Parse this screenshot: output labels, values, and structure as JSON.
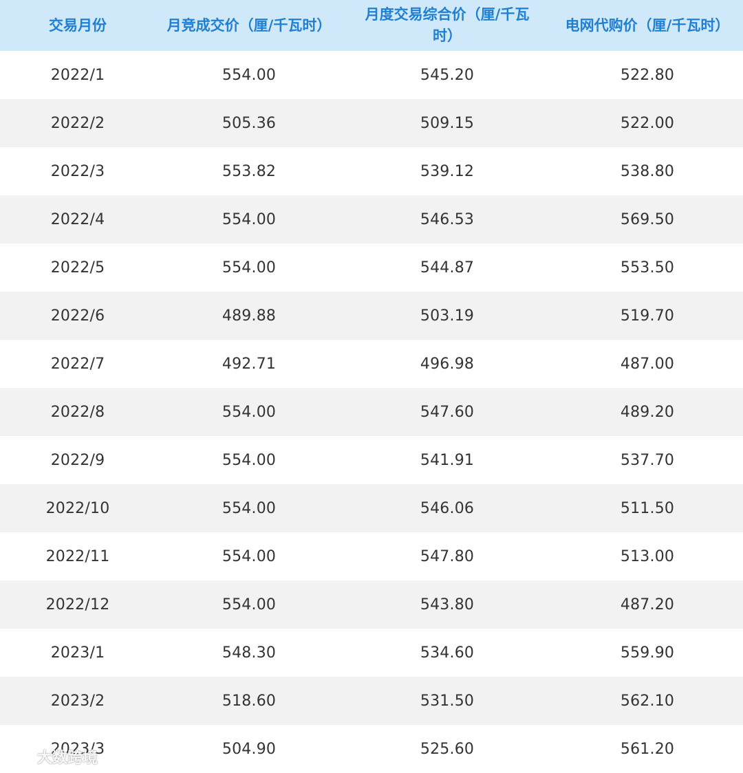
{
  "table": {
    "headers": [
      "交易月份",
      "月竞成交价（厘/千瓦时）",
      "月度交易综合价（厘/千瓦时）",
      "电网代购价（厘/千瓦时）"
    ],
    "rows": [
      [
        "2022/1",
        "554.00",
        "545.20",
        "522.80"
      ],
      [
        "2022/2",
        "505.36",
        "509.15",
        "522.00"
      ],
      [
        "2022/3",
        "553.82",
        "539.12",
        "538.80"
      ],
      [
        "2022/4",
        "554.00",
        "546.53",
        "569.50"
      ],
      [
        "2022/5",
        "554.00",
        "544.87",
        "553.50"
      ],
      [
        "2022/6",
        "489.88",
        "503.19",
        "519.70"
      ],
      [
        "2022/7",
        "492.71",
        "496.98",
        "487.00"
      ],
      [
        "2022/8",
        "554.00",
        "547.60",
        "489.20"
      ],
      [
        "2022/9",
        "554.00",
        "541.91",
        "537.70"
      ],
      [
        "2022/10",
        "554.00",
        "546.06",
        "511.50"
      ],
      [
        "2022/11",
        "554.00",
        "547.80",
        "513.00"
      ],
      [
        "2022/12",
        "554.00",
        "543.80",
        "487.20"
      ],
      [
        "2023/1",
        "548.30",
        "534.60",
        "559.90"
      ],
      [
        "2023/2",
        "518.60",
        "531.50",
        "562.10"
      ],
      [
        "2023/3",
        "504.90",
        "525.60",
        "561.20"
      ]
    ]
  },
  "watermark": {
    "text": "大数跨境",
    "icon": "weibo-eye-logo-icon"
  },
  "colors": {
    "header_bg": "#cfe8fa",
    "header_text": "#1f7fd2",
    "row_alt_bg": "#f2f2f2",
    "body_text": "#333333"
  }
}
